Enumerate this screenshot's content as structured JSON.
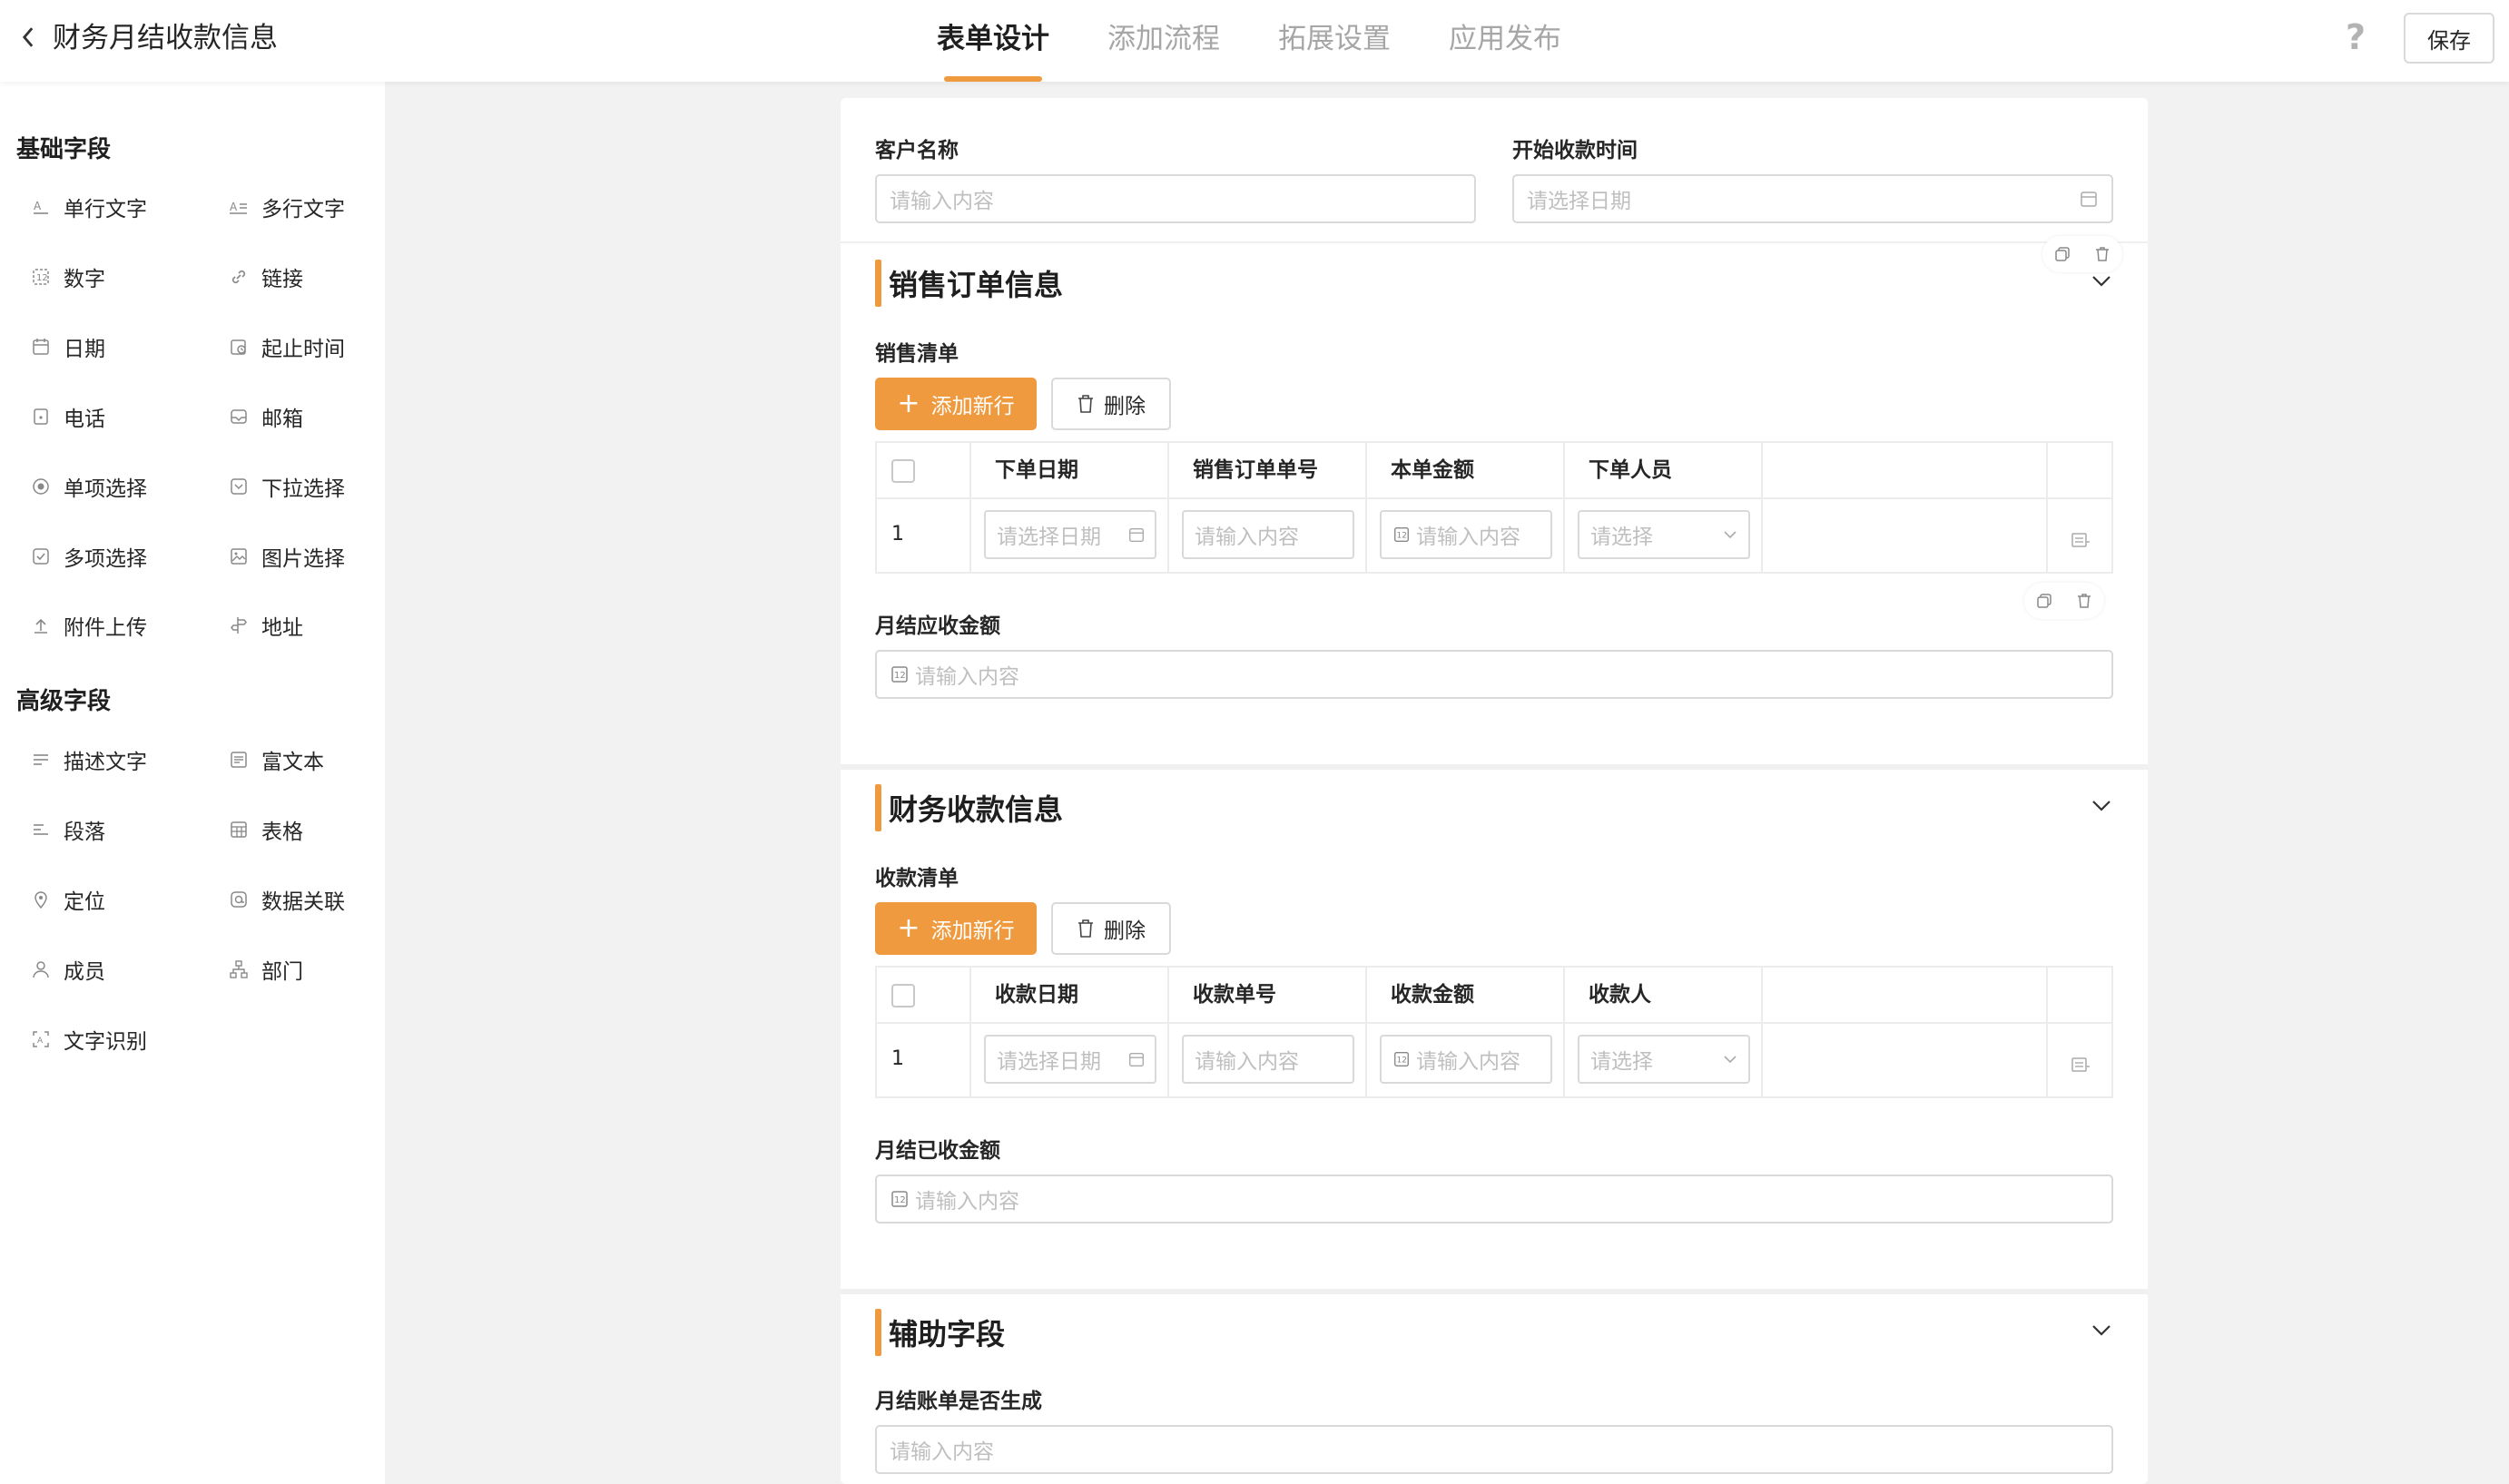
{
  "header": {
    "title": "财务月结收款信息",
    "tabs": [
      {
        "label": "表单设计",
        "active": true
      },
      {
        "label": "添加流程",
        "active": false
      },
      {
        "label": "拓展设置",
        "active": false
      },
      {
        "label": "应用发布",
        "active": false
      }
    ],
    "help": "?",
    "save_label": "保存"
  },
  "sidebar": {
    "basic_title": "基础字段",
    "basic_items": [
      {
        "label": "单行文字",
        "icon": "single-line-text-icon"
      },
      {
        "label": "多行文字",
        "icon": "multi-line-text-icon"
      },
      {
        "label": "数字",
        "icon": "number-icon"
      },
      {
        "label": "链接",
        "icon": "link-icon"
      },
      {
        "label": "日期",
        "icon": "calendar-icon"
      },
      {
        "label": "起止时间",
        "icon": "date-range-icon"
      },
      {
        "label": "电话",
        "icon": "phone-icon"
      },
      {
        "label": "邮箱",
        "icon": "mail-icon"
      },
      {
        "label": "单项选择",
        "icon": "radio-icon"
      },
      {
        "label": "下拉选择",
        "icon": "dropdown-icon"
      },
      {
        "label": "多项选择",
        "icon": "checkbox-icon"
      },
      {
        "label": "图片选择",
        "icon": "image-icon"
      },
      {
        "label": "附件上传",
        "icon": "upload-icon"
      },
      {
        "label": "地址",
        "icon": "signpost-icon"
      }
    ],
    "advanced_title": "高级字段",
    "advanced_items": [
      {
        "label": "描述文字",
        "icon": "description-icon"
      },
      {
        "label": "富文本",
        "icon": "rich-text-icon"
      },
      {
        "label": "段落",
        "icon": "paragraph-icon"
      },
      {
        "label": "表格",
        "icon": "table-icon"
      },
      {
        "label": "定位",
        "icon": "location-pin-icon"
      },
      {
        "label": "数据关联",
        "icon": "data-link-icon"
      },
      {
        "label": "成员",
        "icon": "user-icon"
      },
      {
        "label": "部门",
        "icon": "department-icon"
      },
      {
        "label": "文字识别",
        "icon": "text-recognition-icon"
      }
    ]
  },
  "form": {
    "customer_label": "客户名称",
    "customer_placeholder": "请输入内容",
    "start_time_label": "开始收款时间",
    "start_time_placeholder": "请选择日期",
    "sections": [
      {
        "title": "销售订单信息",
        "subtable_label": "销售清单",
        "add_row_label": "添加新行",
        "delete_label": "删除",
        "columns": [
          "下单日期",
          "销售订单单号",
          "本单金额",
          "下单人员"
        ],
        "row_index": "1",
        "cells": [
          "请选择日期",
          "请输入内容",
          "请输入内容",
          "请选择"
        ],
        "total_label": "月结应收金额",
        "total_placeholder": "请输入内容"
      },
      {
        "title": "财务收款信息",
        "subtable_label": "收款清单",
        "add_row_label": "添加新行",
        "delete_label": "删除",
        "columns": [
          "收款日期",
          "收款单号",
          "收款金额",
          "收款人"
        ],
        "row_index": "1",
        "cells": [
          "请选择日期",
          "请输入内容",
          "请输入内容",
          "请选择"
        ],
        "total_label": "月结已收金额",
        "total_placeholder": "请输入内容"
      },
      {
        "title": "辅助字段",
        "field_label": "月结账单是否生成",
        "field_placeholder": "请输入内容"
      }
    ]
  },
  "colors": {
    "accent": "#ef9a3f",
    "border": "#d9d9d9",
    "placeholder": "#bfbfbf",
    "background": "#f2f2f3"
  }
}
